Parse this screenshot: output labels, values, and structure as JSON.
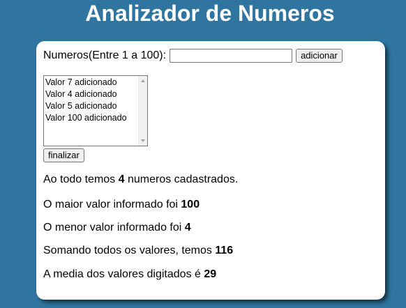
{
  "header": {
    "title": "Analizador de Numeros"
  },
  "form": {
    "number_label": "Numeros(Entre 1 a 100):",
    "number_value": "",
    "add_button_label": "adicionar",
    "finish_button_label": "finalizar"
  },
  "list": {
    "items": [
      "Valor 7 adicionado",
      "Valor 4 adicionado",
      "Valor 5 adicionado",
      "Valor 100 adicionado"
    ]
  },
  "results": {
    "count_prefix": "Ao todo temos ",
    "count_value": "4",
    "count_suffix": " numeros cadastrados.",
    "max_prefix": "O maior valor informado foi ",
    "max_value": "100",
    "min_prefix": "O menor valor informado foi ",
    "min_value": "4",
    "sum_prefix": "Somando todos os valores, temos ",
    "sum_value": "116",
    "avg_prefix": "A media dos valores digitados é ",
    "avg_value": "29"
  },
  "colors": {
    "background": "#2f75a0",
    "panel": "#ffffff",
    "title_text": "#ffffff"
  }
}
